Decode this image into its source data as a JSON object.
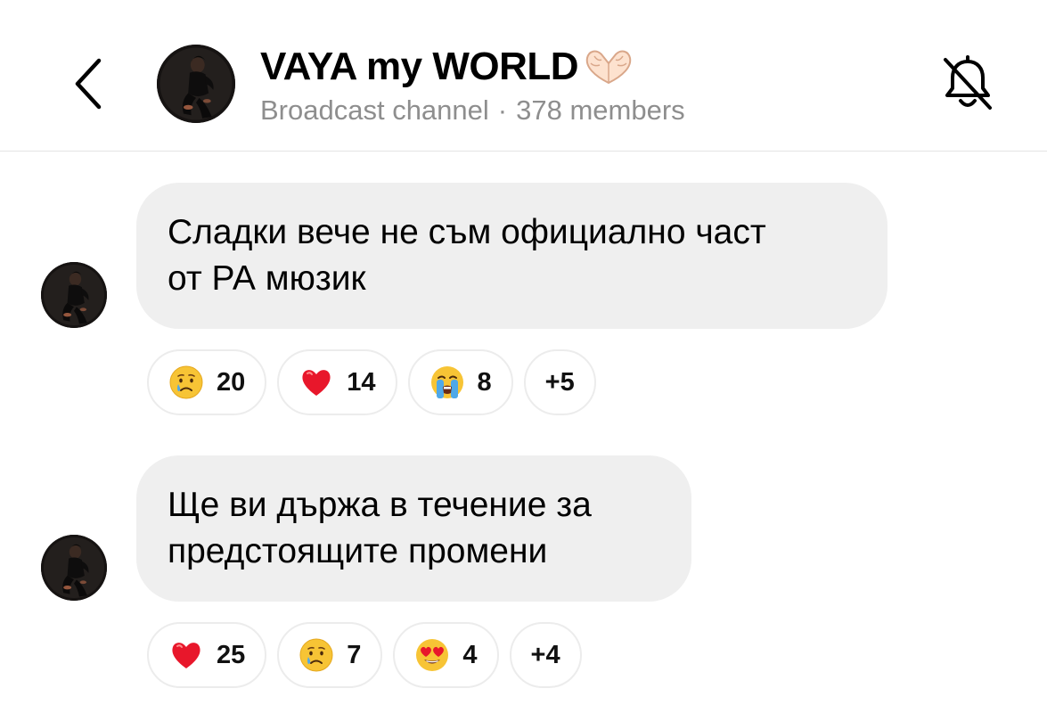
{
  "header": {
    "channel_name": "VAYA my WORLD",
    "title_emoji": "heart-hands",
    "subtitle_kind": "Broadcast channel",
    "subtitle_separator": "·",
    "member_count": "378 members"
  },
  "messages": [
    {
      "lines": [
        "Сладки вече не съм официално част",
        "от РА мюзик"
      ],
      "reactions": [
        {
          "emoji": "crying-face",
          "count": "20"
        },
        {
          "emoji": "red-heart",
          "count": "14"
        },
        {
          "emoji": "loudly-crying-face",
          "count": "8"
        }
      ],
      "more": "+5"
    },
    {
      "lines": [
        "Ще ви държа в течение за",
        "предстоящите промени"
      ],
      "reactions": [
        {
          "emoji": "red-heart",
          "count": "25"
        },
        {
          "emoji": "crying-face",
          "count": "7"
        },
        {
          "emoji": "heart-eyes-face",
          "count": "4"
        }
      ],
      "more": "+4"
    }
  ],
  "colors": {
    "bubble": "#efefef",
    "secondary_text": "#8e8e8e",
    "divider": "#e4e4e4",
    "chip_border": "#ececec"
  }
}
